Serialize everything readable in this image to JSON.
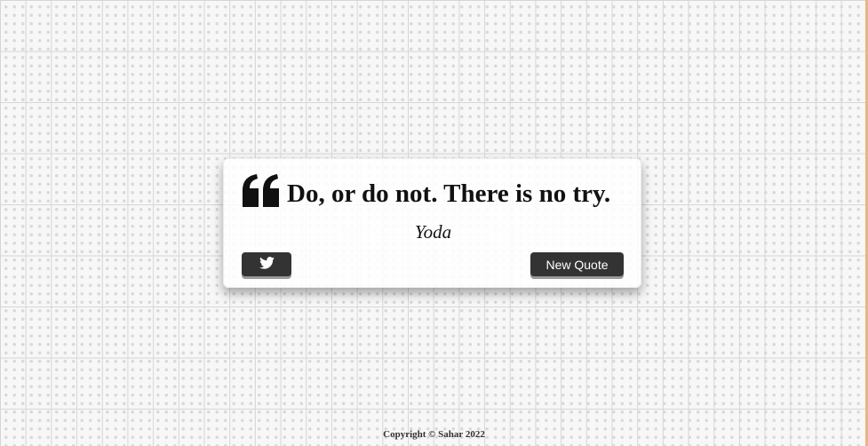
{
  "quote": {
    "text": "Do, or do not. There is no try.",
    "author": "Yoda"
  },
  "buttons": {
    "tweet_icon": "twitter-icon",
    "new_quote_label": "New Quote"
  },
  "icons": {
    "quote": "quote-left-icon",
    "tweet": "twitter-icon"
  },
  "footer": {
    "copyright": "Copyright © Sahar 2022"
  },
  "colors": {
    "button_bg": "#333333",
    "button_text": "#ffffff",
    "text": "#111111"
  }
}
